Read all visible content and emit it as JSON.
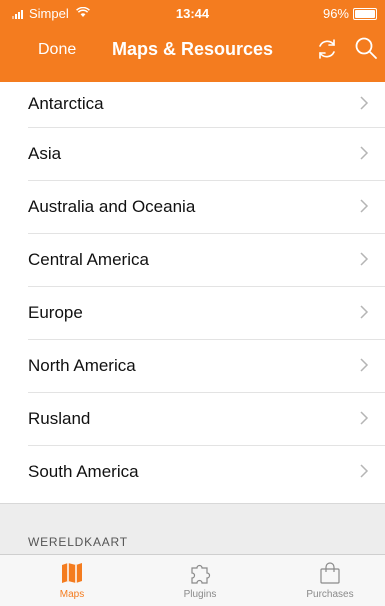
{
  "status_bar": {
    "carrier": "Simpel",
    "time": "13:44",
    "battery": "96%"
  },
  "nav": {
    "done_label": "Done",
    "title": "Maps & Resources",
    "refresh_icon": "refresh-icon",
    "search_icon": "search-icon"
  },
  "list": {
    "items": [
      {
        "label": "Antarctica"
      },
      {
        "label": "Asia"
      },
      {
        "label": "Australia and Oceania"
      },
      {
        "label": "Central America"
      },
      {
        "label": "Europe"
      },
      {
        "label": "North America"
      },
      {
        "label": "Rusland"
      },
      {
        "label": "South America"
      }
    ],
    "section_header": "WERELDKAART"
  },
  "tabbar": {
    "tabs": [
      {
        "label": "Maps",
        "icon": "map-icon",
        "active": true
      },
      {
        "label": "Plugins",
        "icon": "puzzle-icon",
        "active": false
      },
      {
        "label": "Purchases",
        "icon": "shopping-bag-icon",
        "active": false
      }
    ]
  },
  "colors": {
    "accent": "#f47c1f",
    "background": "#ffffff",
    "separator": "#e3e3e3",
    "section_background": "#ededed"
  }
}
